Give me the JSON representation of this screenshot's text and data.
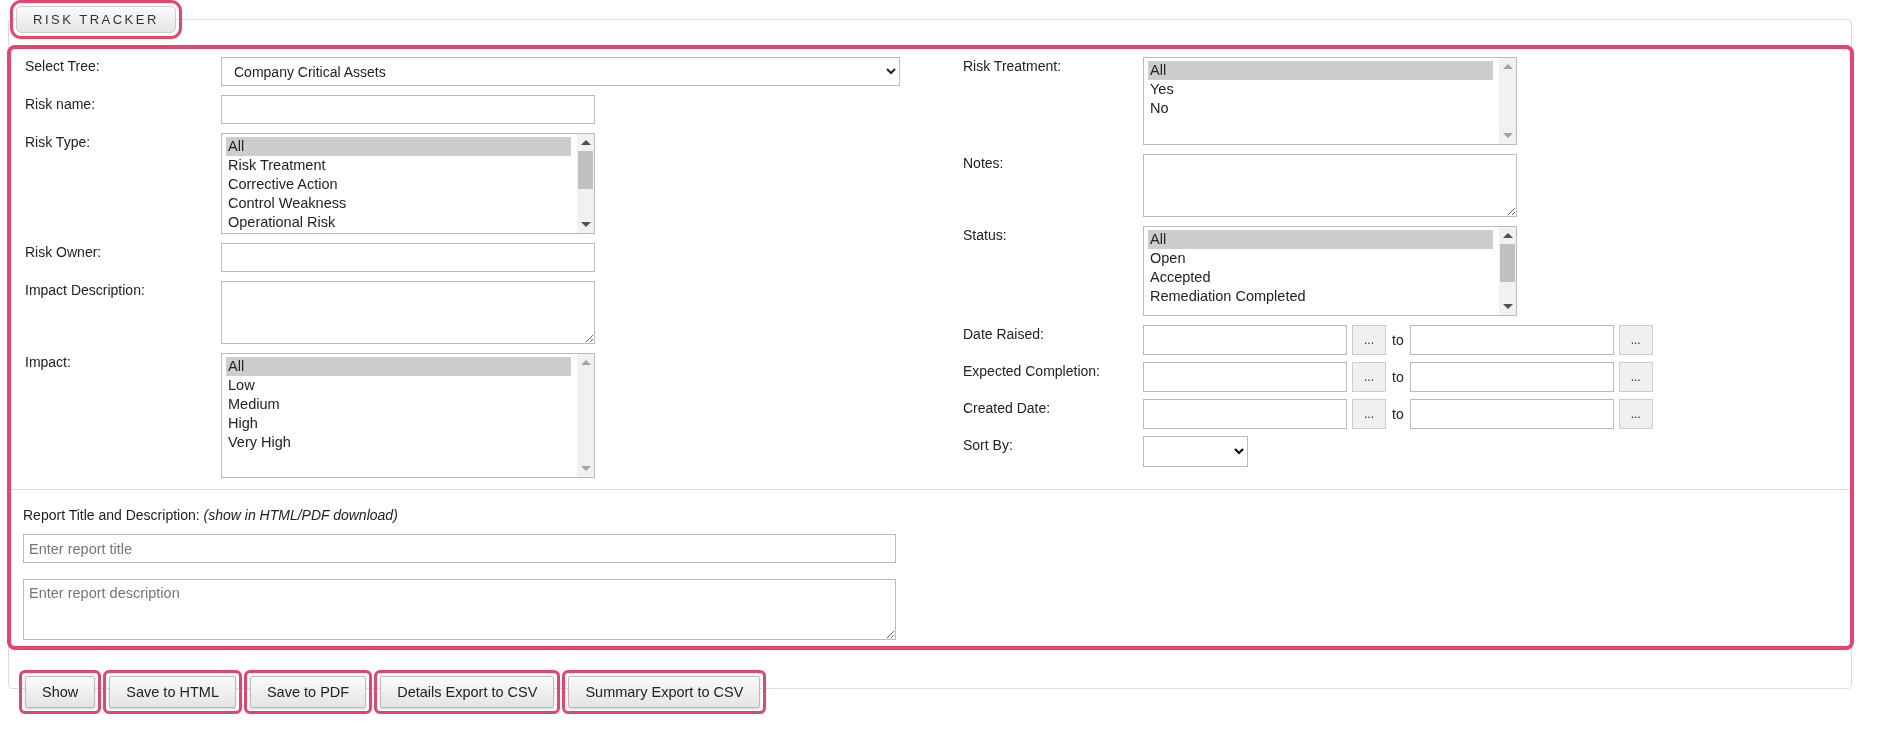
{
  "tab": {
    "label": "RISK TRACKER",
    "highlighted": true
  },
  "form": {
    "highlighted": true,
    "left_fields": [
      {
        "kind": "select",
        "label": "Select Tree:",
        "value": "Company Critical Assets"
      },
      {
        "kind": "text",
        "label": "Risk name:"
      },
      {
        "kind": "listbox",
        "label": "Risk Type:",
        "scrollable": true,
        "options": [
          {
            "label": "All",
            "selected": true
          },
          {
            "label": "Risk Treatment",
            "selected": false
          },
          {
            "label": "Corrective Action",
            "selected": false
          },
          {
            "label": "Control Weakness",
            "selected": false
          },
          {
            "label": "Operational Risk",
            "selected": false
          }
        ]
      },
      {
        "kind": "text",
        "label": "Risk Owner:"
      },
      {
        "kind": "textarea",
        "label": "Impact Description:"
      },
      {
        "kind": "listbox",
        "label": "Impact:",
        "scrollable": false,
        "options": [
          {
            "label": "All",
            "selected": true
          },
          {
            "label": "Low",
            "selected": false
          },
          {
            "label": "Medium",
            "selected": false
          },
          {
            "label": "High",
            "selected": false
          },
          {
            "label": "Very High",
            "selected": false
          }
        ]
      }
    ],
    "right_fields": [
      {
        "kind": "listbox",
        "label": "Risk Treatment:",
        "scrollable": false,
        "options": [
          {
            "label": "All",
            "selected": true
          },
          {
            "label": "Yes",
            "selected": false
          },
          {
            "label": "No",
            "selected": false
          }
        ]
      },
      {
        "kind": "textarea",
        "label": "Notes:"
      },
      {
        "kind": "listbox",
        "label": "Status:",
        "scrollable": true,
        "options": [
          {
            "label": "All",
            "selected": true
          },
          {
            "label": "Open",
            "selected": false
          },
          {
            "label": "Accepted",
            "selected": false
          },
          {
            "label": "Remediation Completed",
            "selected": false
          }
        ]
      },
      {
        "kind": "date-range",
        "label": "Date Raised:",
        "from_button": "...",
        "separator": "to",
        "to_button": "..."
      },
      {
        "kind": "date-range",
        "label": "Expected Completion:",
        "from_button": "...",
        "separator": "to",
        "to_button": "..."
      },
      {
        "kind": "date-range",
        "label": "Created Date:",
        "from_button": "...",
        "separator": "to",
        "to_button": "..."
      },
      {
        "kind": "select-small",
        "label": "Sort By:"
      }
    ],
    "report": {
      "label": "Report Title and Description: *(show in HTML/PDF download)*",
      "title_placeholder": "Enter report title",
      "description_placeholder": "Enter report description"
    }
  },
  "buttons": [
    {
      "label": "Show",
      "highlighted": true
    },
    {
      "label": "Save to HTML",
      "highlighted": true
    },
    {
      "label": "Save to PDF",
      "highlighted": true
    },
    {
      "label": "Details Export to CSV",
      "highlighted": true
    },
    {
      "label": "Summary Export to CSV",
      "highlighted": true
    }
  ]
}
